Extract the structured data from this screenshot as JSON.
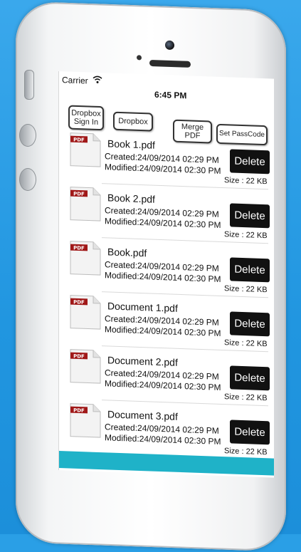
{
  "status_bar": {
    "carrier": "Carrier",
    "time": "6:45 PM",
    "wifi_icon": "wifi-icon"
  },
  "toolbar": {
    "dropbox_signin_line1": "Dropbox",
    "dropbox_signin_line2": "Sign In",
    "dropbox_label": "Dropbox",
    "merge_line1": "Merge",
    "merge_line2": "PDF",
    "set_passcode_label": "Set PassCode"
  },
  "files": [
    {
      "name": "Book 1.pdf",
      "created": "Created:24/09/2014 02:29 PM",
      "modified": "Modified:24/09/2014 02:30 PM",
      "size": "Size : 22 KB",
      "delete_label": "Delete",
      "icon": "pdf-file-icon",
      "icon_label": "PDF"
    },
    {
      "name": "Book 2.pdf",
      "created": "Created:24/09/2014 02:29 PM",
      "modified": "Modified:24/09/2014 02:30 PM",
      "size": "Size : 22 KB",
      "delete_label": "Delete",
      "icon": "pdf-file-icon",
      "icon_label": "PDF"
    },
    {
      "name": "Book.pdf",
      "created": "Created:24/09/2014 02:29 PM",
      "modified": "Modified:24/09/2014 02:30 PM",
      "size": "Size : 22 KB",
      "delete_label": "Delete",
      "icon": "pdf-file-icon",
      "icon_label": "PDF"
    },
    {
      "name": "Document 1.pdf",
      "created": "Created:24/09/2014 02:29 PM",
      "modified": "Modified:24/09/2014 02:30 PM",
      "size": "Size : 22 KB",
      "delete_label": "Delete",
      "icon": "pdf-file-icon",
      "icon_label": "PDF"
    },
    {
      "name": "Document 2.pdf",
      "created": "Created:24/09/2014 02:29 PM",
      "modified": "Modified:24/09/2014 02:30 PM",
      "size": "Size : 22 KB",
      "delete_label": "Delete",
      "icon": "pdf-file-icon",
      "icon_label": "PDF"
    },
    {
      "name": "Document 3.pdf",
      "created": "Created:24/09/2014 02:29 PM",
      "modified": "Modified:24/09/2014 02:30 PM",
      "size": "Size : 22 KB",
      "delete_label": "Delete",
      "icon": "pdf-file-icon",
      "icon_label": "PDF"
    }
  ],
  "colors": {
    "background": "#2a9fe6",
    "delete_button": "#111111",
    "bottom_bar": "#1fb2c8",
    "pdf_badge": "#a01818"
  }
}
